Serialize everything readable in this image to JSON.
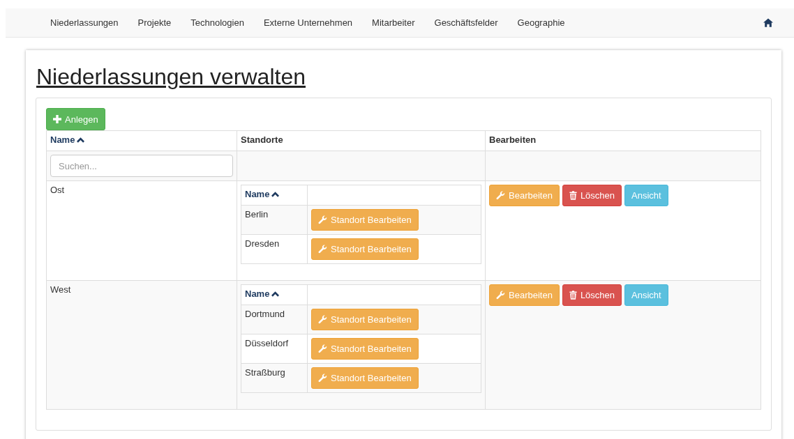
{
  "navbar": {
    "items": [
      {
        "label": "Niederlassungen"
      },
      {
        "label": "Projekte"
      },
      {
        "label": "Technologien"
      },
      {
        "label": "Externe Unternehmen"
      },
      {
        "label": "Mitarbeiter"
      },
      {
        "label": "Geschäftsfelder"
      },
      {
        "label": "Geographie"
      }
    ]
  },
  "page": {
    "title": "Niederlassungen verwalten"
  },
  "create_button": {
    "label": "Anlegen"
  },
  "table": {
    "columns": [
      {
        "label": "Name",
        "sortable": true
      },
      {
        "label": "Standorte",
        "sortable": false
      },
      {
        "label": "Bearbeiten",
        "sortable": false
      }
    ],
    "search": {
      "placeholder": "Suchen..."
    },
    "rows": [
      {
        "name": "Ost",
        "locations": {
          "column": "Name",
          "items": [
            {
              "name": "Berlin",
              "action": "Standort Bearbeiten"
            },
            {
              "name": "Dresden",
              "action": "Standort Bearbeiten"
            }
          ]
        },
        "actions": [
          {
            "kind": "edit",
            "label": "Bearbeiten"
          },
          {
            "kind": "delete",
            "label": "Löschen"
          },
          {
            "kind": "view",
            "label": "Ansicht"
          }
        ]
      },
      {
        "name": "West",
        "locations": {
          "column": "Name",
          "items": [
            {
              "name": "Dortmund",
              "action": "Standort Bearbeiten"
            },
            {
              "name": "Düsseldorf",
              "action": "Standort Bearbeiten"
            },
            {
              "name": "Straßburg",
              "action": "Standort Bearbeiten"
            }
          ]
        },
        "actions": [
          {
            "kind": "edit",
            "label": "Bearbeiten"
          },
          {
            "kind": "delete",
            "label": "Löschen"
          },
          {
            "kind": "view",
            "label": "Ansicht"
          }
        ]
      }
    ]
  }
}
